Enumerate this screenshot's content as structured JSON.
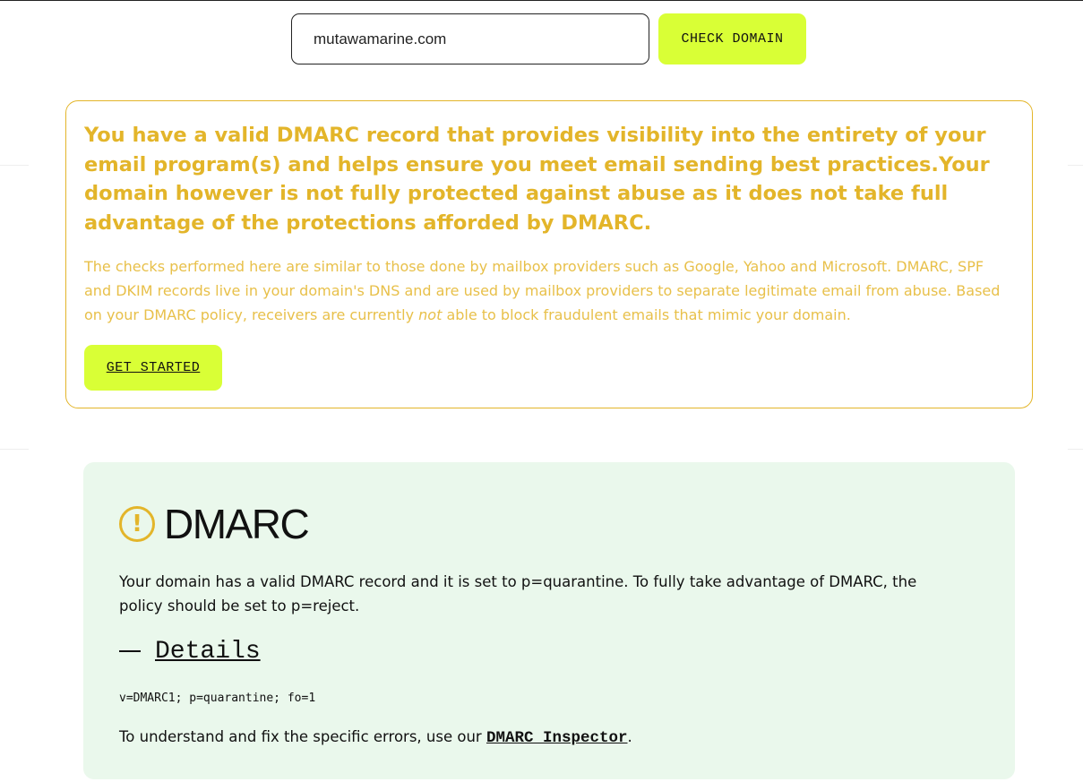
{
  "search": {
    "value": "mutawamarine.com",
    "button_label": "CHECK DOMAIN"
  },
  "alert": {
    "headline": "You have a valid DMARC record that provides visibility into the entirety of your email program(s) and helps ensure you meet email sending best practices.Your domain however is not fully protected against abuse as it does not take full advantage of the protections afforded by DMARC.",
    "body_before": "The checks performed here are similar to those done by mailbox providers such as Google, Yahoo and Microsoft. DMARC, SPF and DKIM records live in your domain's DNS and are used by mailbox providers to separate legitimate email from abuse. Based on your DMARC policy, receivers are currently ",
    "body_emphasis": "not",
    "body_after": " able to block fraudulent emails that mimic your domain.",
    "button_label": "GET STARTED",
    "color": "#e3b52a"
  },
  "dmarc": {
    "icon": "warning-icon",
    "icon_glyph": "!",
    "title": "DMARC",
    "description": "Your domain has a valid DMARC record and it is set to p=quarantine. To fully take advantage of DMARC, the policy should be set to p=reject.",
    "details_label": "Details",
    "record": "v=DMARC1; p=quarantine; fo=1",
    "inspector_prefix": "To understand and fix the specific errors, use our ",
    "inspector_link": "DMARC Inspector",
    "inspector_suffix": ".",
    "background": "#eaf8ec"
  },
  "colors": {
    "accent": "#d9ff36",
    "warning": "#e3b52a"
  }
}
